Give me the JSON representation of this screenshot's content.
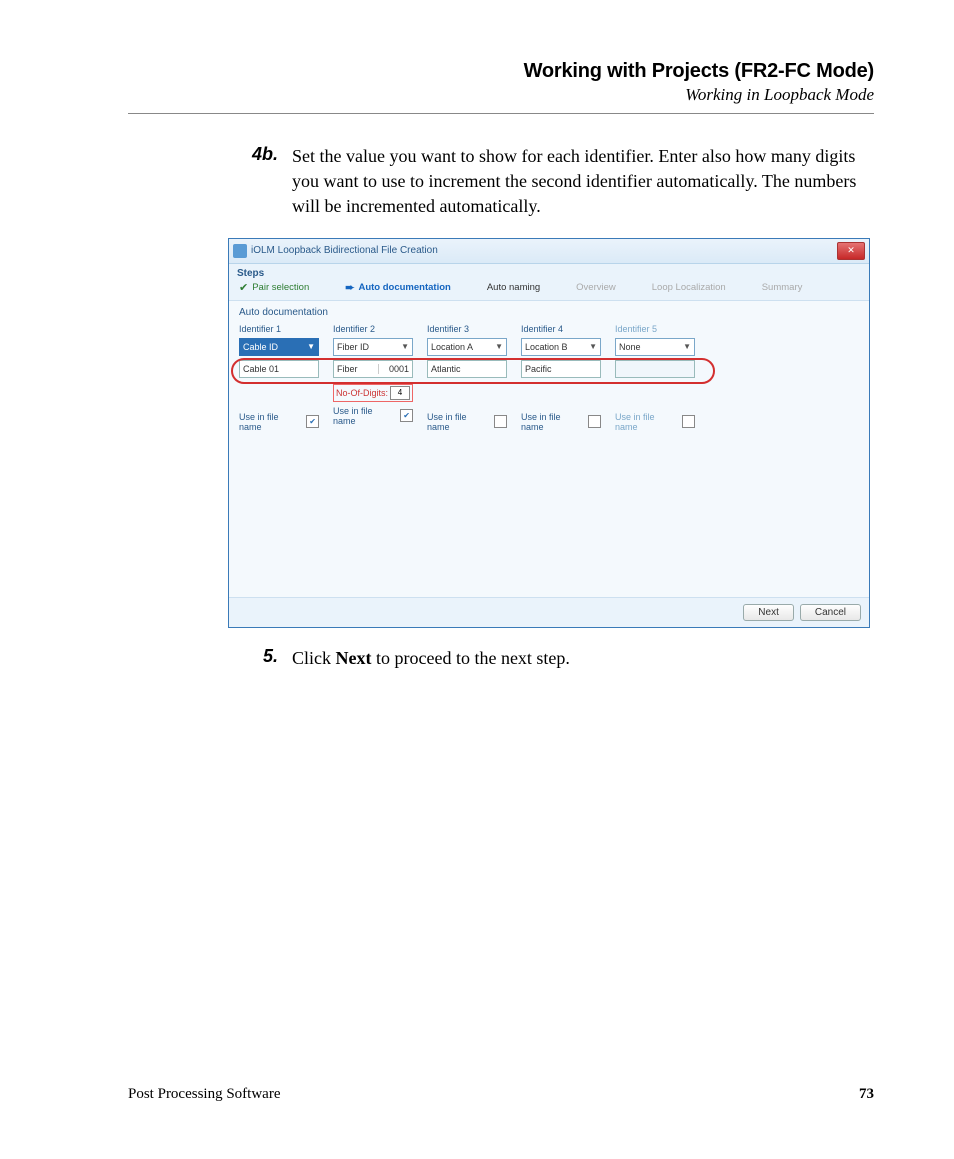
{
  "header": {
    "title": "Working with Projects (FR2-FC Mode)",
    "subtitle": "Working in Loopback Mode"
  },
  "steps_text": {
    "s4b_num": "4b.",
    "s4b_body": "Set the value you want to show for each identifier. Enter also how many digits you want to use to increment the second identifier automatically. The numbers will be incremented automatically.",
    "s5_num": "5.",
    "s5_pre": "Click ",
    "s5_bold": "Next",
    "s5_post": " to proceed to the next step."
  },
  "dialog": {
    "title": "iOLM Loopback Bidirectional File Creation",
    "steps_label": "Steps",
    "tabs": {
      "pair": "Pair selection",
      "auto_doc": "Auto documentation",
      "auto_naming": "Auto naming",
      "overview": "Overview",
      "loop": "Loop Localization",
      "summary": "Summary"
    },
    "section": "Auto documentation",
    "identifiers": [
      {
        "label": "Identifier 1",
        "type": "Cable ID",
        "value": "Cable 01",
        "use_checked": true,
        "highlighted": true
      },
      {
        "label": "Identifier 2",
        "type": "Fiber ID",
        "value_left": "Fiber",
        "value_right": "0001",
        "use_checked": true,
        "digits_label": "No-Of-Digits:",
        "digits_value": "4"
      },
      {
        "label": "Identifier 3",
        "type": "Location A",
        "value": "Atlantic",
        "use_checked": false
      },
      {
        "label": "Identifier 4",
        "type": "Location B",
        "value": "Pacific",
        "use_checked": false
      },
      {
        "label": "Identifier 5",
        "type": "None",
        "value": "",
        "use_checked": false,
        "dim": true
      }
    ],
    "use_label": "Use in file name",
    "buttons": {
      "next": "Next",
      "cancel": "Cancel"
    }
  },
  "footer": {
    "product": "Post Processing Software",
    "page": "73"
  }
}
